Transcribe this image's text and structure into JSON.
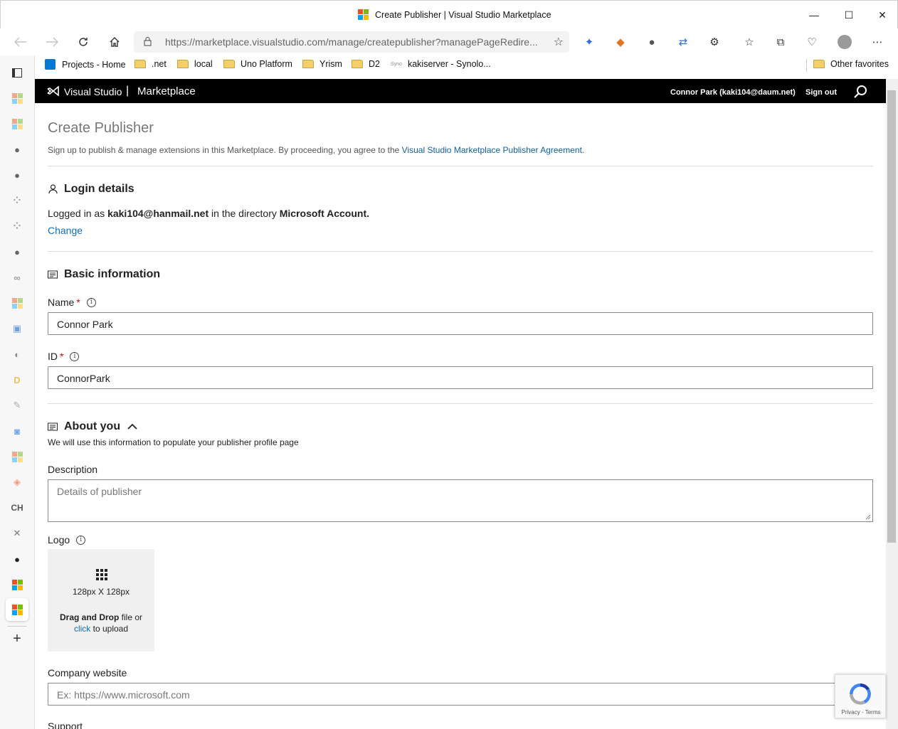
{
  "window": {
    "title": "Create Publisher | Visual Studio Marketplace",
    "minimize": "—",
    "maximize": "☐",
    "close": "✕"
  },
  "browser": {
    "url_host": "https://marketplace.visualstudio.com",
    "url_path": "/manage/createpublisher?managePageRedire..."
  },
  "favorites": {
    "items": [
      {
        "label": "Projects - Home",
        "icon": "azure-devops-icon"
      },
      {
        "label": ".net",
        "icon": "folder-icon"
      },
      {
        "label": "local",
        "icon": "folder-icon"
      },
      {
        "label": "Uno Platform",
        "icon": "folder-icon"
      },
      {
        "label": "Yrism",
        "icon": "folder-icon"
      },
      {
        "label": "D2",
        "icon": "folder-icon"
      },
      {
        "label": "kakiserver - Synolo...",
        "icon": "synology-icon",
        "prefix": "Syno"
      }
    ],
    "other": "Other favorites"
  },
  "header": {
    "brand": "Visual Studio",
    "separator": "|",
    "product": "Marketplace",
    "user": "Connor Park (kaki104@daum.net)",
    "signout": "Sign out"
  },
  "page": {
    "title": "Create Publisher",
    "subtitle": "Sign up to publish & manage extensions in this Marketplace. By proceeding, you agree to the",
    "agreement_link": "Visual Studio Marketplace Publisher Agreement",
    "subtitle_end": "."
  },
  "login": {
    "heading": "Login details",
    "logged_in_as": "Logged in as",
    "email": "kaki104@hanmail.net",
    "in_directory": "in the directory",
    "directory": "Microsoft Account.",
    "change": "Change"
  },
  "basic": {
    "heading": "Basic information",
    "name_label": "Name",
    "name_value": "Connor Park",
    "id_label": "ID",
    "id_value": "ConnorPark",
    "required_mark": "*"
  },
  "about": {
    "heading": "About you",
    "subtitle": "We will use this information to populate your publisher profile page",
    "description_label": "Description",
    "description_placeholder": "Details of publisher",
    "logo_label": "Logo",
    "logo_size": "128px X 128px",
    "drag_drop": "Drag and Drop",
    "file_or": "file or",
    "click": "click",
    "to_upload": "to upload",
    "website_label": "Company website",
    "website_placeholder": "Ex: https://www.microsoft.com",
    "support_label": "Support"
  },
  "recaptcha": {
    "privacy": "Privacy",
    "dash": "-",
    "terms": "Terms"
  },
  "colors": {
    "accent_link": "#0f6fb5",
    "header_bg": "#000000",
    "required": "#cc0000"
  }
}
